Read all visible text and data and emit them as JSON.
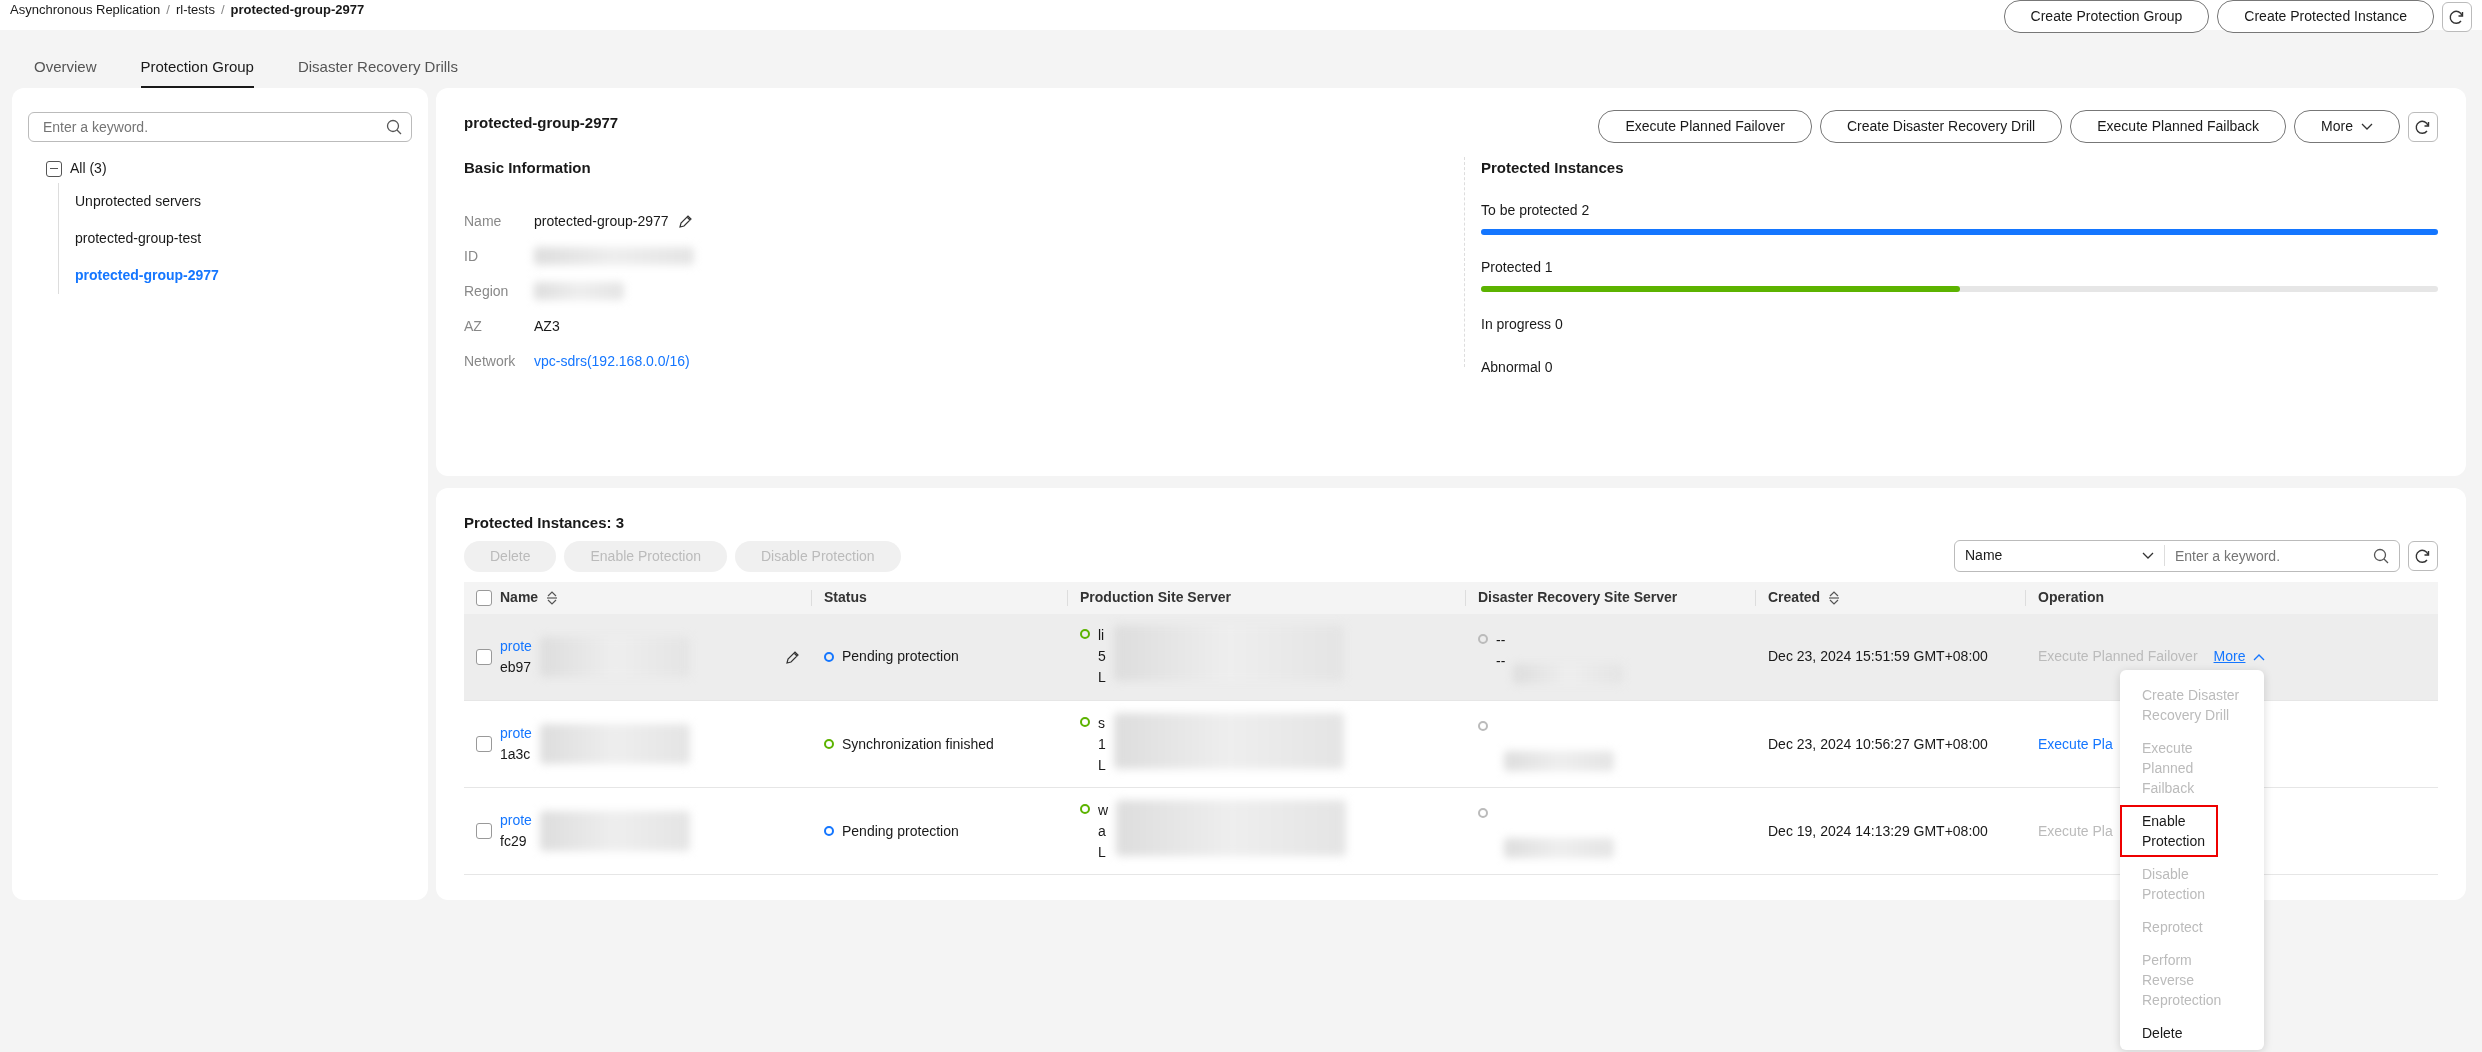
{
  "breadcrumb_separator": "/",
  "breadcrumb": [
    {
      "label": "Asynchronous Replication",
      "current": false
    },
    {
      "label": "rl-tests",
      "current": false
    },
    {
      "label": "protected-group-2977",
      "current": true
    }
  ],
  "header_buttons": [
    "Create Protection Group",
    "Create Protected Instance"
  ],
  "tabs": [
    {
      "label": "Overview",
      "selected": false
    },
    {
      "label": "Protection Group",
      "selected": true
    },
    {
      "label": "Disaster Recovery Drills",
      "selected": false
    }
  ],
  "sidebar": {
    "search": {
      "placeholder": "Enter a keyword."
    },
    "tree": {
      "label": "All (3)",
      "expanded": true,
      "children": [
        {
          "label": "Unprotected servers",
          "selected": false
        },
        {
          "label": "protected-group-test",
          "selected": false
        },
        {
          "label": "protected-group-2977",
          "selected": true
        }
      ]
    }
  },
  "group": {
    "title": "protected-group-2977",
    "actions": [
      "Execute Planned Failover",
      "Create Disaster Recovery Drill",
      "Execute Planned Failback"
    ],
    "more": "More",
    "basic_info": {
      "title": "Basic Information",
      "fields": [
        {
          "label": "Name",
          "value": "protected-group-2977",
          "editable": true,
          "kind": "text"
        },
        {
          "label": "ID",
          "kind": "redacted"
        },
        {
          "label": "Region",
          "kind": "redacted"
        },
        {
          "label": "AZ",
          "value": "AZ3",
          "kind": "text"
        },
        {
          "label": "Network",
          "value": "vpc-sdrs(192.168.0.0/16)",
          "kind": "link"
        }
      ]
    },
    "instances": {
      "title": "Protected Instances",
      "stats": [
        {
          "label": "To be protected 2",
          "level": 1,
          "color": "#1476ff"
        },
        {
          "label": "Protected 1",
          "level": 0.5,
          "color": "#5cb300"
        },
        {
          "label": "In progress 0"
        },
        {
          "label": "Abnormal 0"
        }
      ]
    }
  },
  "table": {
    "title": "Protected Instances: 3",
    "bulk_actions": [
      "Delete",
      "Enable Protection",
      "Disable Protection"
    ],
    "filter": {
      "field": "Name",
      "placeholder": "Enter a keyword."
    },
    "select_all_checked": false,
    "columns": [
      {
        "label": "Name",
        "sortable": true
      },
      {
        "label": "Status",
        "sortable": false
      },
      {
        "label": "Production Site Server",
        "sortable": false
      },
      {
        "label": "Disaster Recovery Site Server",
        "sortable": false
      },
      {
        "label": "Created",
        "sortable": true
      },
      {
        "label": "Operation",
        "sortable": false
      }
    ],
    "rows": [
      {
        "checked": false,
        "hovered": true,
        "name": "prote",
        "id": "eb97",
        "editable": true,
        "status": "Pending protection",
        "color": "#1476ff",
        "production": [
          "li",
          "5",
          "L"
        ],
        "dr": [
          "--",
          "--"
        ],
        "created": "Dec 23, 2024 15:51:59 GMT+08:00",
        "operation": {
          "label": "Execute Planned Failover",
          "disabled": true
        },
        "more": {
          "label": "More",
          "expanded": true
        }
      },
      {
        "checked": false,
        "hovered": false,
        "name": "prote",
        "id": "1a3c",
        "editable": false,
        "status": "Synchronization finished",
        "color": "#5cb300",
        "production": [
          "s",
          "1",
          "L"
        ],
        "dr": [],
        "created": "Dec 23, 2024 10:56:27 GMT+08:00",
        "operation": {
          "label": "Execute Pla",
          "disabled": false
        }
      },
      {
        "checked": false,
        "hovered": false,
        "name": "prote",
        "id": "fc29",
        "editable": false,
        "status": "Pending protection",
        "color": "#1476ff",
        "production": [
          "w",
          "a",
          "L"
        ],
        "dr": [],
        "created": "Dec 19, 2024 14:13:29 GMT+08:00",
        "operation": {
          "label": "Execute Pla",
          "disabled": true
        }
      }
    ]
  },
  "menu": [
    {
      "label": "Create Disaster Recovery Drill",
      "disabled": true,
      "highlighted": false
    },
    {
      "label": "Execute Planned Failback",
      "disabled": true,
      "highlighted": false
    },
    {
      "label": "Enable Protection",
      "disabled": false,
      "highlighted": true
    },
    {
      "label": "Disable Protection",
      "disabled": true,
      "highlighted": false
    },
    {
      "label": "Reprotect",
      "disabled": true,
      "highlighted": false
    },
    {
      "label": "Perform Reverse Reprotection",
      "disabled": true,
      "highlighted": false
    },
    {
      "label": "Delete",
      "disabled": false,
      "highlighted": false
    }
  ]
}
